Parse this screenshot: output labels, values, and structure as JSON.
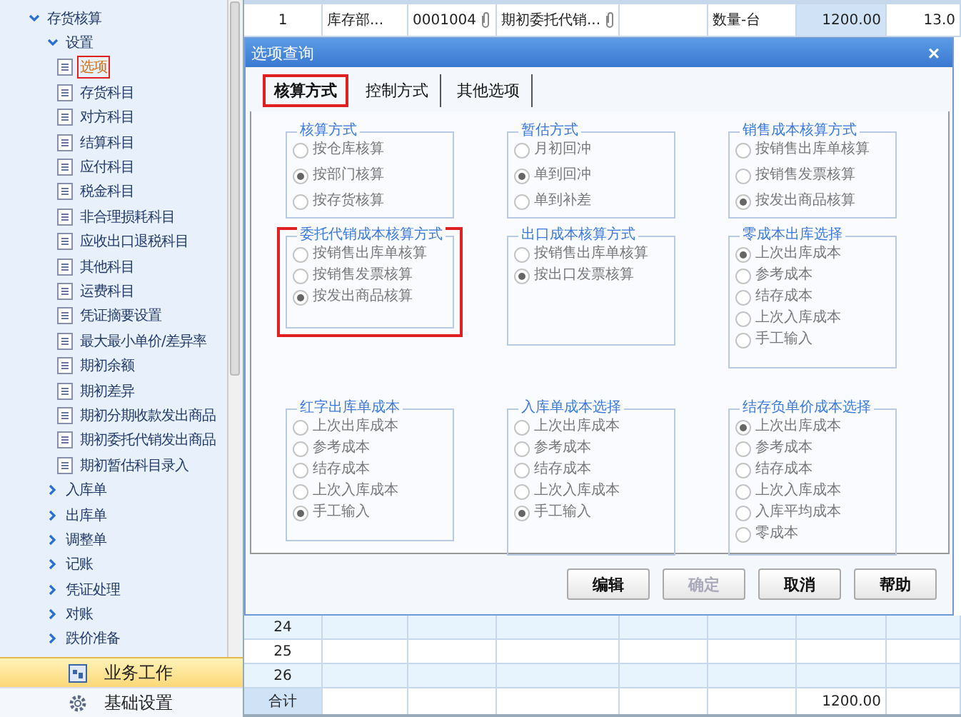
{
  "sidebar": {
    "tree": [
      {
        "label": "存货核算",
        "expanded": true,
        "selected": false,
        "children": [
          {
            "label": "设置",
            "expanded": true,
            "selected": false,
            "children": [
              {
                "label": "选项",
                "selected": true,
                "highlighted": true
              },
              {
                "label": "存货科目",
                "selected": false,
                "highlighted": false
              },
              {
                "label": "对方科目",
                "selected": false,
                "highlighted": false
              },
              {
                "label": "结算科目",
                "selected": false,
                "highlighted": false
              },
              {
                "label": "应付科目",
                "selected": false,
                "highlighted": false
              },
              {
                "label": "税金科目",
                "selected": false,
                "highlighted": false
              },
              {
                "label": "非合理损耗科目",
                "selected": false,
                "highlighted": false
              },
              {
                "label": "应收出口退税科目",
                "selected": false,
                "highlighted": false
              },
              {
                "label": "其他科目",
                "selected": false,
                "highlighted": false
              },
              {
                "label": "运费科目",
                "selected": false,
                "highlighted": false
              },
              {
                "label": "凭证摘要设置",
                "selected": false,
                "highlighted": false
              },
              {
                "label": "最大最小单价/差异率",
                "selected": false,
                "highlighted": false
              },
              {
                "label": "期初余额",
                "selected": false,
                "highlighted": false
              },
              {
                "label": "期初差异",
                "selected": false,
                "highlighted": false
              },
              {
                "label": "期初分期收款发出商品",
                "selected": false,
                "highlighted": false
              },
              {
                "label": "期初委托代销发出商品",
                "selected": false,
                "highlighted": false
              },
              {
                "label": "期初暂估科目录入",
                "selected": false,
                "highlighted": false
              }
            ]
          },
          {
            "label": "入库单",
            "expanded": false,
            "selected": false
          },
          {
            "label": "出库单",
            "expanded": false,
            "selected": false
          },
          {
            "label": "调整单",
            "expanded": false,
            "selected": false
          },
          {
            "label": "记账",
            "expanded": false,
            "selected": false
          },
          {
            "label": "凭证处理",
            "expanded": false,
            "selected": false
          },
          {
            "label": "对账",
            "expanded": false,
            "selected": false
          },
          {
            "label": "跌价准备",
            "expanded": false,
            "selected": false
          }
        ]
      }
    ],
    "nav": [
      {
        "label": "业务工作",
        "selected": true,
        "kind": "work"
      },
      {
        "label": "基础设置",
        "selected": false,
        "kind": "settings"
      }
    ]
  },
  "table": {
    "top_rows": [
      {
        "cells": [
          {
            "text": "1"
          },
          {
            "text": "库存部..."
          },
          {
            "text": "0001004",
            "attachment": true
          },
          {
            "text": "期初委托代销...",
            "attachment": true
          },
          {},
          {
            "text": "数量-台"
          },
          {
            "text": "1200.00",
            "selected": true
          },
          {
            "text": "13.0"
          }
        ]
      }
    ],
    "bottom_rows": [
      {
        "number": "24"
      },
      {
        "number": "25"
      },
      {
        "number": "26"
      }
    ],
    "total": {
      "label": "合计",
      "amount": "1200.00"
    }
  },
  "dialog": {
    "title": "选项查询",
    "close": "×",
    "tabs": [
      {
        "label": "核算方式",
        "selected": true,
        "highlighted": true
      },
      {
        "label": "控制方式",
        "selected": false,
        "highlighted": false
      },
      {
        "label": "其他选项",
        "selected": false,
        "highlighted": false
      }
    ],
    "groups": [
      {
        "title": "核算方式",
        "highlighted": false,
        "options": [
          {
            "label": "按仓库核算",
            "selected": false
          },
          {
            "label": "按部门核算",
            "selected": true
          },
          {
            "label": "按存货核算",
            "selected": false
          }
        ]
      },
      {
        "title": "暂估方式",
        "highlighted": false,
        "options": [
          {
            "label": "月初回冲",
            "selected": false
          },
          {
            "label": "单到回冲",
            "selected": true
          },
          {
            "label": "单到补差",
            "selected": false
          }
        ]
      },
      {
        "title": "销售成本核算方式",
        "highlighted": false,
        "options": [
          {
            "label": "按销售出库单核算",
            "selected": false
          },
          {
            "label": "按销售发票核算",
            "selected": false
          },
          {
            "label": "按发出商品核算",
            "selected": true
          }
        ]
      },
      {
        "title": "委托代销成本核算方式",
        "highlighted": true,
        "options": [
          {
            "label": "按销售出库单核算",
            "selected": false
          },
          {
            "label": "按销售发票核算",
            "selected": false
          },
          {
            "label": "按发出商品核算",
            "selected": true
          }
        ]
      },
      {
        "title": "出口成本核算方式",
        "highlighted": false,
        "options": [
          {
            "label": "按销售出库单核算",
            "selected": false
          },
          {
            "label": "按出口发票核算",
            "selected": true
          }
        ]
      },
      {
        "title": "零成本出库选择",
        "highlighted": false,
        "options": [
          {
            "label": "上次出库成本",
            "selected": true
          },
          {
            "label": "参考成本",
            "selected": false
          },
          {
            "label": "结存成本",
            "selected": false
          },
          {
            "label": "上次入库成本",
            "selected": false
          },
          {
            "label": "手工输入",
            "selected": false
          }
        ]
      },
      {
        "title": "红字出库单成本",
        "highlighted": false,
        "options": [
          {
            "label": "上次出库成本",
            "selected": false
          },
          {
            "label": "参考成本",
            "selected": false
          },
          {
            "label": "结存成本",
            "selected": false
          },
          {
            "label": "上次入库成本",
            "selected": false
          },
          {
            "label": "手工输入",
            "selected": true
          }
        ]
      },
      {
        "title": "入库单成本选择",
        "highlighted": false,
        "options": [
          {
            "label": "上次出库成本",
            "selected": false
          },
          {
            "label": "参考成本",
            "selected": false
          },
          {
            "label": "结存成本",
            "selected": false
          },
          {
            "label": "上次入库成本",
            "selected": false
          },
          {
            "label": "手工输入",
            "selected": true
          }
        ]
      },
      {
        "title": "结存负单价成本选择",
        "highlighted": false,
        "options": [
          {
            "label": "上次出库成本",
            "selected": true
          },
          {
            "label": "参考成本",
            "selected": false
          },
          {
            "label": "结存成本",
            "selected": false
          },
          {
            "label": "上次入库成本",
            "selected": false
          },
          {
            "label": "入库平均成本",
            "selected": false
          },
          {
            "label": "零成本",
            "selected": false
          }
        ]
      }
    ],
    "buttons": [
      {
        "label": "编辑",
        "disabled": false
      },
      {
        "label": "确定",
        "disabled": true
      },
      {
        "label": "取消",
        "disabled": false
      },
      {
        "label": "帮助",
        "disabled": false
      }
    ]
  }
}
